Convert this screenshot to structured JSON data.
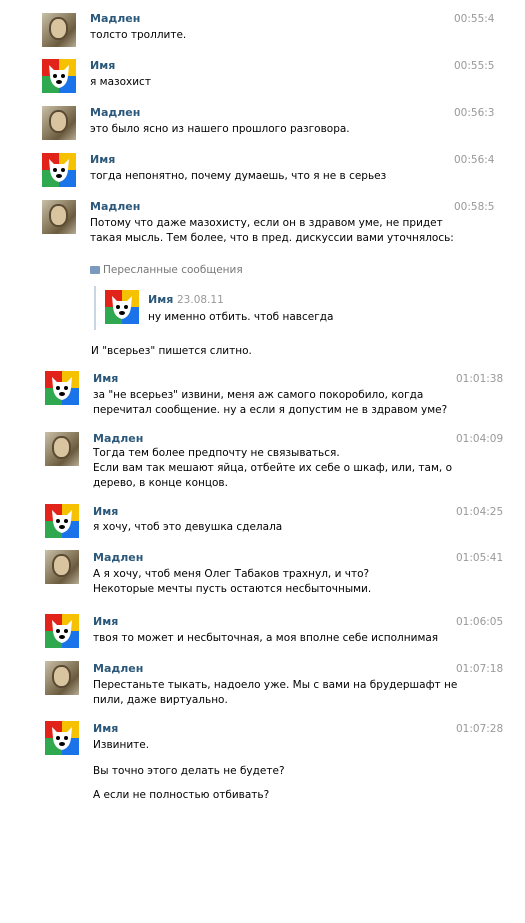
{
  "messages": [
    {
      "author": "Мадлен",
      "time": "00:55:4",
      "text": "толсто троллите.",
      "avatar": "photo-avatar"
    },
    {
      "author": "Имя",
      "time": "00:55:5",
      "text": "я мазохист",
      "avatar": "vk-dog-avatar"
    },
    {
      "author": "Мадлен",
      "time": "00:56:3",
      "text": "это было ясно из нашего прошлого разговора.",
      "avatar": "photo-avatar"
    },
    {
      "author": "Имя",
      "time": "00:56:4",
      "text": "тогда непонятно, почему думаешь, что я не в серьез",
      "avatar": "vk-dog-avatar"
    },
    {
      "author": "Мадлен",
      "time": "00:58:5",
      "text": "Потому что даже мазохисту, если он в здравом уме, не придет\nтакая мысль. Тем более, что в пред. дискуссии вами уточнялось:",
      "avatar": "photo-avatar"
    },
    {
      "author": "Имя",
      "time": "01:01:38",
      "text": "за \"не всерьез\" извини, меня аж самого покоробило, когда\nперечитал сообщение. ну а если я допустим не в здравом уме?",
      "avatar": "vk-dog-avatar"
    },
    {
      "author": "Мадлен",
      "time": "01:04:09",
      "text": "Тогда тем более предпочту не связываться.\nЕсли вам так мешают яйца, отбейте их себе о шкаф, или, там, о\nдерево, в конце концов.",
      "avatar": "photo-avatar"
    },
    {
      "author": "Имя",
      "time": "01:04:25",
      "text": "я хочу, чтоб это девушка сделала",
      "avatar": "vk-dog-avatar"
    },
    {
      "author": "Мадлен",
      "time": "01:05:41",
      "text": "А я хочу, чтоб меня Олег Табаков трахнул, и что?\nНекоторые мечты пусть остаются несбыточными.",
      "avatar": "photo-avatar"
    },
    {
      "author": "Имя",
      "time": "01:06:05",
      "text": "твоя то может и несбыточная, а моя вполне себе исполнимая",
      "avatar": "vk-dog-avatar"
    },
    {
      "author": "Мадлен",
      "time": "01:07:18",
      "text": "Перестаньте тыкать, надоело уже. Мы с вами на брудершафт не\nпили, даже виртуально.",
      "avatar": "photo-avatar"
    },
    {
      "author": "Имя",
      "time": "01:07:28",
      "text": "Извините.",
      "avatar": "vk-dog-avatar"
    }
  ],
  "forwarded": {
    "label": "Пересланные сообщения",
    "author": "Имя",
    "date": "23.08.11",
    "text": "ну именно отбить. чтоб навсегда",
    "avatar": "vk-dog-avatar"
  },
  "extra_lines": {
    "vserez_note": "И \"всерьез\" пишется слитно.",
    "followup_1": "Вы точно этого делать не будете?",
    "followup_2": "А если не полностью отбивать?"
  },
  "colors": {
    "name": "#2b587a",
    "time": "#999999",
    "vk_red": "#e2231a",
    "vk_yellow": "#f6c100",
    "vk_green": "#2fa84f",
    "vk_blue": "#1a73e8"
  }
}
